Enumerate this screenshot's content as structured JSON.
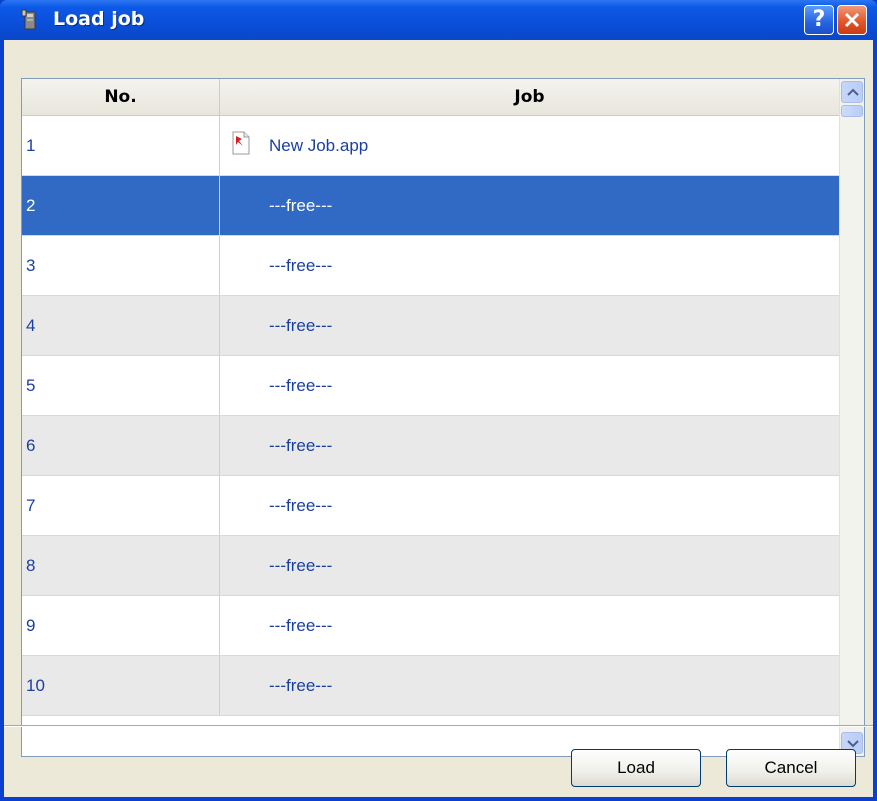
{
  "window": {
    "title": "Load job",
    "help_button": "?",
    "accent": "#0a4ed9"
  },
  "grid": {
    "columns": [
      "No.",
      "Job"
    ],
    "rows": [
      {
        "no": "1",
        "job": "New Job.app"
      },
      {
        "no": "2",
        "job": "---free---"
      },
      {
        "no": "3",
        "job": "---free---"
      },
      {
        "no": "4",
        "job": "---free---"
      },
      {
        "no": "5",
        "job": "---free---"
      },
      {
        "no": "6",
        "job": "---free---"
      },
      {
        "no": "7",
        "job": "---free---"
      },
      {
        "no": "8",
        "job": "---free---"
      },
      {
        "no": "9",
        "job": "---free---"
      },
      {
        "no": "10",
        "job": "---free---"
      }
    ],
    "selected_row": "2",
    "selection_color": "#316ac5"
  },
  "buttons": {
    "load": "Load",
    "cancel": "Cancel"
  }
}
